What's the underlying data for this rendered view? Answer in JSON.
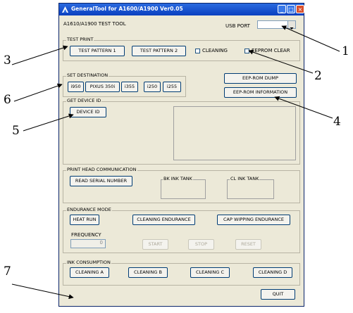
{
  "window": {
    "title": "GeneralTool for A1600/A1900 Ver0.05"
  },
  "header": {
    "app_label": "A1610/A1900 TEST TOOL",
    "usb_port_label": "USB PORT",
    "usb_port_value": ""
  },
  "test_print": {
    "title": "TEST PRINT",
    "btn1": "TEST PATTERN 1",
    "btn2": "TEST PATTERN 2",
    "cleaning": "CLEANING",
    "eeprom_clear": "EEPROM CLEAR"
  },
  "set_destination": {
    "title": "SET DESTINATION",
    "b1": "i950",
    "b2": "PIXUS 350i",
    "b3": "i355",
    "b4": "i250",
    "b5": "i255"
  },
  "eeprom": {
    "dump": "EEP-ROM DUMP",
    "info": "EEP-ROM INFORMATION"
  },
  "device_id": {
    "title": "GET DEVICE ID",
    "button": "DEVICE ID"
  },
  "print_head": {
    "title": "PRINT HEAD COMMUNICATION",
    "read_serial": "READ SERIAL NUMBER",
    "bk_tank": "BK INK TANK",
    "cl_tank": "CL INK TANK"
  },
  "endurance": {
    "title": "ENDURANCE MODE",
    "heat_run": "HEAT RUN",
    "cleaning_endurance": "CLEANING ENDURANCE",
    "cap_wiping": "CAP WIPPING ENDURANCE",
    "frequency_label": "FREQUENCY",
    "frequency_value": "0",
    "start": "START",
    "stop": "STOP",
    "reset": "RESET"
  },
  "ink": {
    "title": "INK CONSUMPTION",
    "a": "CLEANING A",
    "b": "CLEANING B",
    "c": "CLEANING C",
    "d": "CLEANING D"
  },
  "quit": "QUIT",
  "callouts": [
    "1",
    "2",
    "3",
    "4",
    "5",
    "6",
    "7"
  ]
}
